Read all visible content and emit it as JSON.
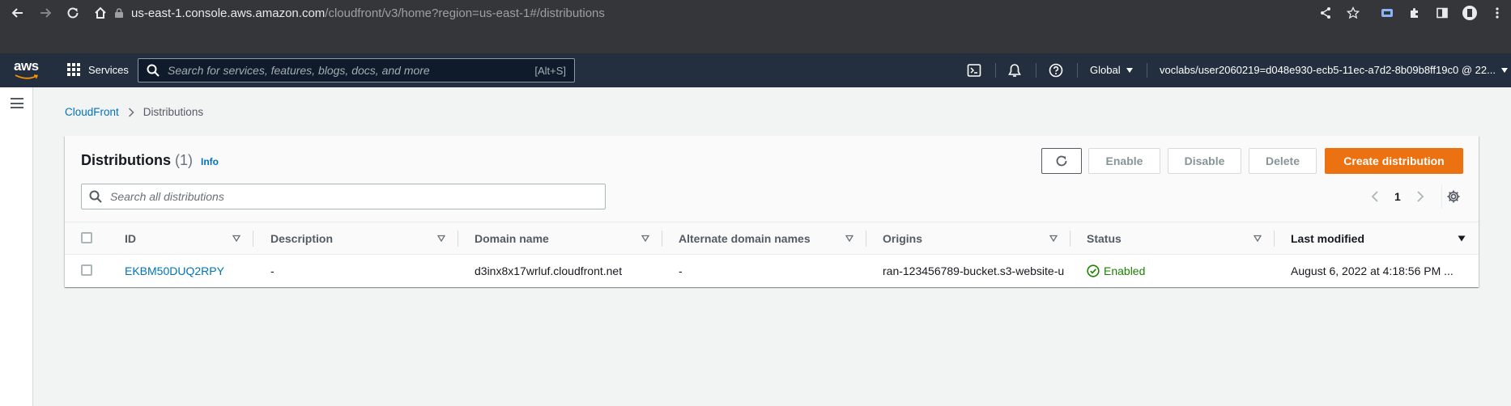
{
  "browser": {
    "url_host": "us-east-1.console.aws.amazon.com",
    "url_path": "/cloudfront/v3/home?region=us-east-1#/distributions"
  },
  "aws_nav": {
    "logo": "aws",
    "services_label": "Services",
    "search_placeholder": "Search for services, features, blogs, docs, and more",
    "search_shortcut": "[Alt+S]",
    "region_label": "Global",
    "account_label": "voclabs/user2060219=d048e930-ecb5-11ec-a7d2-8b09b8ff19c0 @ 22..."
  },
  "breadcrumb": {
    "root": "CloudFront",
    "current": "Distributions"
  },
  "distributions": {
    "title": "Distributions",
    "count": "(1)",
    "info_label": "Info",
    "buttons": {
      "enable": "Enable",
      "disable": "Disable",
      "delete": "Delete",
      "create": "Create distribution"
    },
    "filter_placeholder": "Search all distributions",
    "page_number": "1",
    "columns": [
      "ID",
      "Description",
      "Domain name",
      "Alternate domain names",
      "Origins",
      "Status",
      "Last modified"
    ],
    "rows": [
      {
        "id": "EKBM50DUQ2RPY",
        "description": "-",
        "domain_name": "d3inx8x17wrluf.cloudfront.net",
        "alternate_domain_names": "-",
        "origins": "ran-123456789-bucket.s3-website-u",
        "status": "Enabled",
        "last_modified": "August 6, 2022 at 4:18:56 PM ..."
      }
    ]
  },
  "colors": {
    "nav_bg": "#232f3e",
    "primary_button": "#ec7211",
    "link": "#0073bb",
    "success": "#1d8102"
  }
}
